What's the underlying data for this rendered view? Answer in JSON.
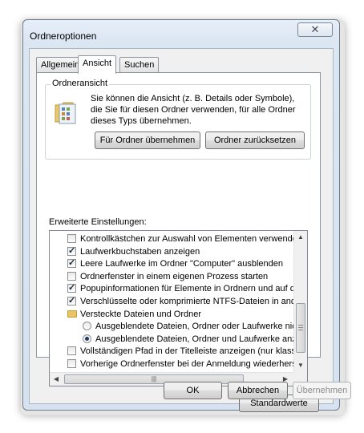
{
  "window": {
    "title": "Ordneroptionen",
    "close_symbol": "✕"
  },
  "tabs": [
    {
      "label": "Allgemein"
    },
    {
      "label": "Ansicht"
    },
    {
      "label": "Suchen"
    }
  ],
  "folder_view": {
    "group_title": "Ordneransicht",
    "description": "Sie können die Ansicht (z. B. Details oder Symbole), die Sie für diesen Ordner verwenden, für alle Ordner dieses Typs übernehmen.",
    "apply_button": "Für Ordner übernehmen",
    "reset_button": "Ordner zurücksetzen"
  },
  "advanced": {
    "label": "Erweiterte Einstellungen:",
    "items": [
      {
        "type": "checkbox",
        "checked": false,
        "indent": 1,
        "label": "Kontrollkästchen zur Auswahl von Elementen verwenden"
      },
      {
        "type": "checkbox",
        "checked": true,
        "indent": 1,
        "label": "Laufwerkbuchstaben anzeigen"
      },
      {
        "type": "checkbox",
        "checked": true,
        "indent": 1,
        "label": "Leere Laufwerke im Ordner \"Computer\" ausblenden"
      },
      {
        "type": "checkbox",
        "checked": false,
        "indent": 1,
        "label": "Ordnerfenster in einem eigenen Prozess starten"
      },
      {
        "type": "checkbox",
        "checked": true,
        "indent": 1,
        "label": "Popupinformationen für Elemente in Ordnern und auf dem D"
      },
      {
        "type": "checkbox",
        "checked": true,
        "indent": 1,
        "label": "Verschlüsselte oder komprimierte NTFS-Dateien in anderer"
      },
      {
        "type": "folder",
        "indent": 1,
        "label": "Versteckte Dateien und Ordner"
      },
      {
        "type": "radio",
        "checked": false,
        "indent": 2,
        "label": "Ausgeblendete Dateien, Ordner oder Laufwerke nicht a"
      },
      {
        "type": "radio",
        "checked": true,
        "indent": 2,
        "label": "Ausgeblendete Dateien, Ordner und Laufwerke anzeig"
      },
      {
        "type": "checkbox",
        "checked": false,
        "indent": 1,
        "label": "Vollständigen Pfad in der Titelleiste anzeigen (nur klassisch"
      },
      {
        "type": "checkbox",
        "checked": false,
        "indent": 1,
        "label": "Vorherige Ordnerfenster bei der Anmeldung wiederherstellen"
      }
    ],
    "scroll": {
      "up_icon": "▲",
      "down_icon": "▼",
      "left_icon": "◀",
      "right_icon": "▶",
      "hgrip": "|||"
    }
  },
  "defaults_button": "Standardwerte",
  "footer": {
    "ok": "OK",
    "cancel": "Abbrechen",
    "apply": "Übernehmen",
    "apply_enabled": false
  }
}
